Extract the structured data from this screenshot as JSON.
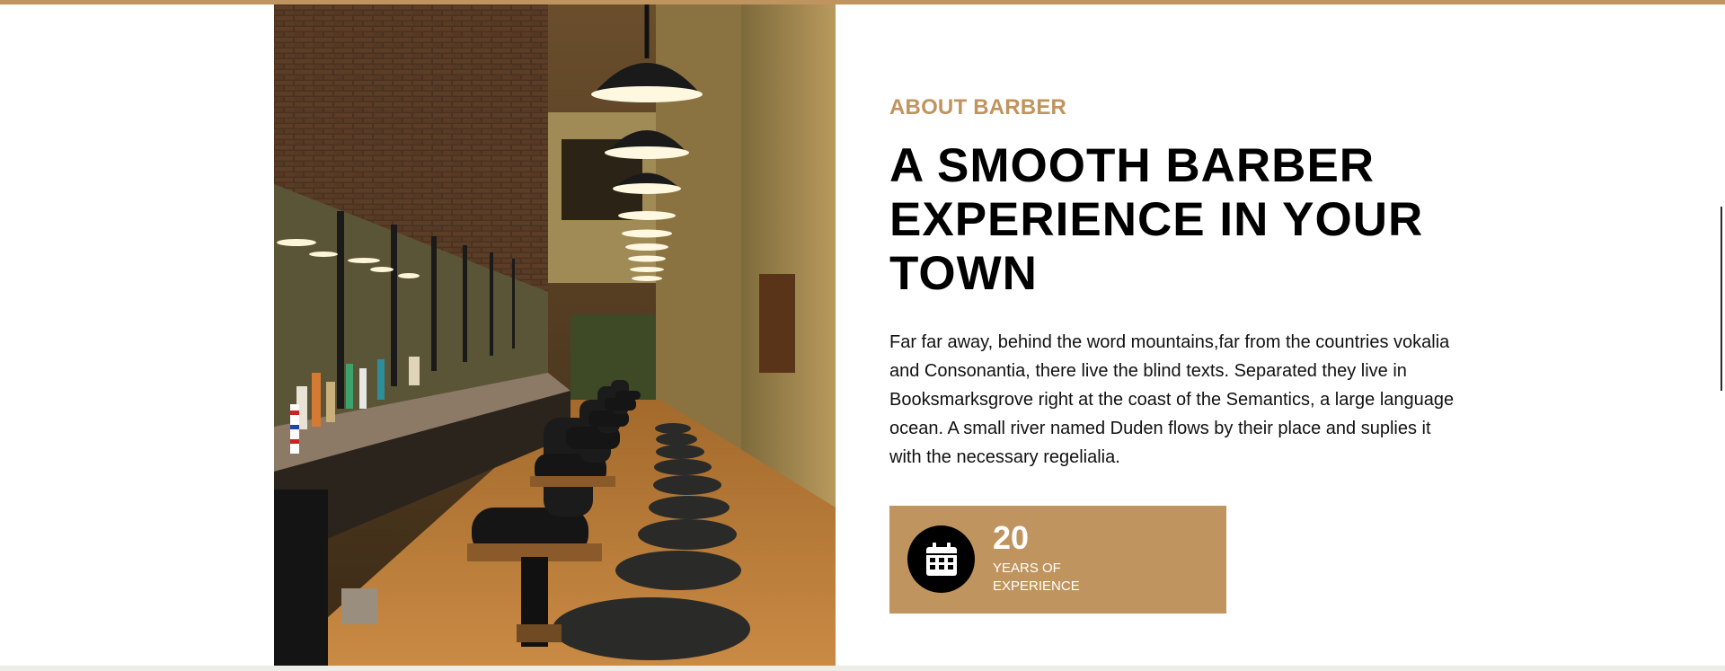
{
  "about": {
    "eyebrow": "ABOUT BARBER",
    "heading": "A SMOOTH BARBER EXPERIENCE IN YOUR TOWN",
    "paragraph": "Far far away, behind the word mountains,far from the countries vokalia and Consonantia, there live the blind texts. Separated they live in Booksmarksgrove right at the coast of the Semantics, a large language ocean. A small river named Duden flows by their place and suplies it with the necessary regelialia."
  },
  "stat": {
    "value": "20",
    "label": "YEARS OF EXPERIENCE",
    "icon": "calendar-icon"
  },
  "image": {
    "subject": "barbershop-interior-photo"
  },
  "colors": {
    "accent": "#c0945e",
    "heading": "#000000",
    "text": "#111111"
  }
}
